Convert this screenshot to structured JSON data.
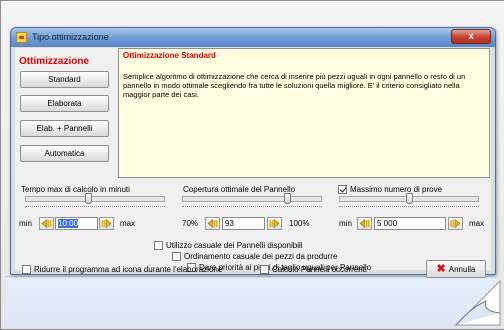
{
  "window": {
    "title": "Tipo ottimizzazione",
    "close_label": "x"
  },
  "left_panel": {
    "title": "Ottimizzazione",
    "buttons": [
      {
        "label": "Standard"
      },
      {
        "label": "Elaborata"
      },
      {
        "label": "Elab. + Pannelli"
      },
      {
        "label": "Automatica"
      }
    ]
  },
  "info": {
    "title": "Ottimizzazione Standard",
    "description": "Semplice algoritmo di ottimizzazione che cerca di inserire più pezzi uguali in ogni pannello o resto di un pannello in modo ottimale scegliendo fra tutte le soluzioni quella migliore. E' il criterio consigliato nella maggior parte dei casi."
  },
  "time_control": {
    "label": "Tempo max di calcolo in minuti",
    "min_label": "min",
    "max_label": "max",
    "value": "10:00",
    "slider_fraction": 0.45
  },
  "coverage_control": {
    "label": "Copertura ottimale del Pannello",
    "min_label": "70%",
    "max_label": "100%",
    "value": "93",
    "slider_fraction": 0.77
  },
  "attempts_control": {
    "label": "Massimo numero di prove",
    "checked": true,
    "min_label": "min",
    "max_label": "max",
    "value": "5 000",
    "slider_fraction": 0.5
  },
  "options": {
    "random_panels": {
      "label": "Utilizzo casuale dei Pannelli disponibili",
      "checked": false
    },
    "random_order": {
      "label": "Ordinamento casuale dei pezzi da produrre",
      "checked": false
    },
    "priority_plans": {
      "label": "Dare priorità ai piani di taglio uguali per Pannello",
      "checked": false
    },
    "minimize_icon": {
      "label": "Ridurre il programma ad icona durante l'elaborazione",
      "checked": false
    },
    "calc_panels": {
      "label": "Calcolo Pannelli occorrenti",
      "checked": false
    }
  },
  "cancel_button": {
    "label": "Annulla"
  },
  "icons": [
    "app-icon",
    "close-icon",
    "arrow-left-icon",
    "arrow-right-icon",
    "cancel-x-icon",
    "page-curl-icon"
  ]
}
